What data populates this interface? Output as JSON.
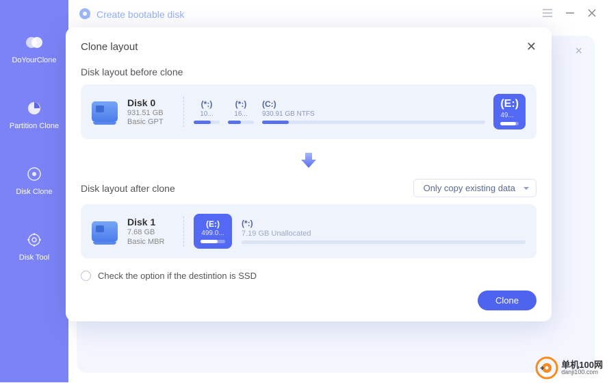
{
  "app": {
    "name": "DoYourClone"
  },
  "topbar": {
    "title": "Create bootable disk"
  },
  "sidebar": {
    "items": [
      {
        "label": "DoYourClone"
      },
      {
        "label": "Partition Clone"
      },
      {
        "label": "Disk Clone"
      },
      {
        "label": "Disk Tool"
      }
    ]
  },
  "modal": {
    "title": "Clone layout",
    "before_label": "Disk layout before clone",
    "after_label": "Disk layout after clone",
    "dropdown_value": "Only copy existing data",
    "ssd_check_label": "Check the option if the destintion is SSD",
    "clone_button": "Clone"
  },
  "disk_before": {
    "name": "Disk 0",
    "size": "931.51 GB",
    "type": "Basic GPT",
    "partitions": [
      {
        "label": "(*:)",
        "detail": "10...",
        "fill": 65
      },
      {
        "label": "(*:)",
        "detail": "16...",
        "fill": 50
      },
      {
        "label": "(C:)",
        "detail": "930.91 GB NTFS",
        "fill": 12
      },
      {
        "label": "(E:)",
        "detail": "49...",
        "fill": 85
      }
    ]
  },
  "disk_after": {
    "name": "Disk 1",
    "size": "7.68 GB",
    "type": "Basic MBR",
    "e_partition": {
      "label": "(E:)",
      "detail": "499.0...",
      "fill": 70
    },
    "unallocated": {
      "label": "(*:)",
      "detail": "7.19 GB Unallocated"
    }
  },
  "watermark": {
    "cn": "单机100网",
    "url": "danji100.com"
  }
}
